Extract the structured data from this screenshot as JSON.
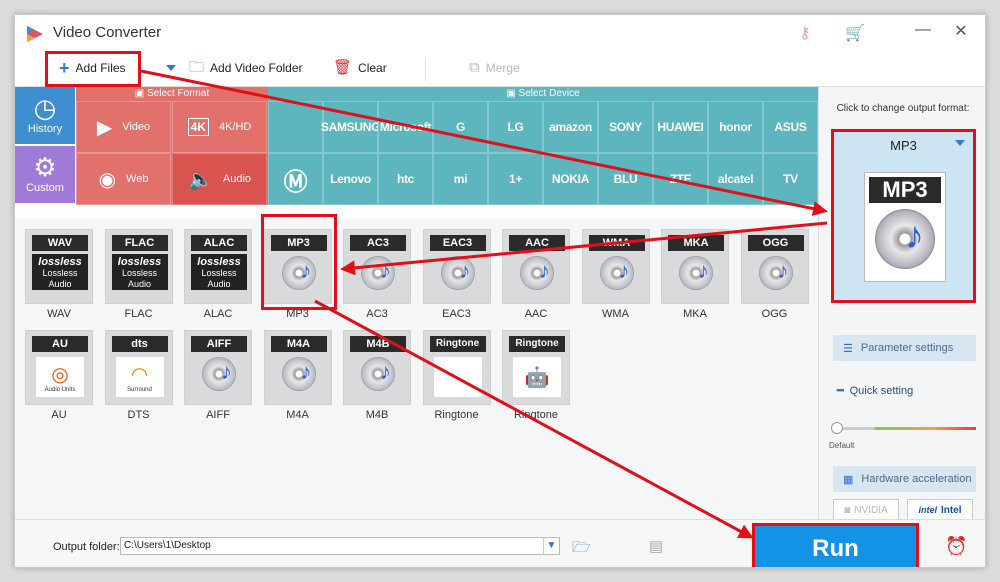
{
  "window": {
    "title": "Video Converter"
  },
  "toolbar": {
    "add_files": "Add Files",
    "add_video_folder": "Add Video Folder",
    "clear": "Clear",
    "merge": "Merge"
  },
  "format_bar": {
    "select_format": "Select Format",
    "select_device": "Select Device",
    "side": [
      {
        "label": "History",
        "icon": "clock-icon"
      },
      {
        "label": "Custom",
        "icon": "gear-icon"
      }
    ],
    "formats": [
      {
        "label": "Video",
        "icon": "play-icon"
      },
      {
        "label": "4K/HD",
        "icon": "4k-icon"
      },
      {
        "label": "Web",
        "icon": "chrome-icon"
      },
      {
        "label": "Audio",
        "icon": "speaker-icon"
      }
    ],
    "devices_row1": [
      "",
      "SAMSUNG",
      "Microsoft",
      "G",
      "LG",
      "amazon",
      "SONY",
      "HUAWEI",
      "honor",
      "ASUS"
    ],
    "devices_row2": [
      "",
      "Lenovo",
      "htc",
      "mi",
      "1+",
      "NOKIA",
      "BLU",
      "ZTE",
      "alcatel",
      "TV"
    ]
  },
  "audio_formats": [
    {
      "badge": "WAV",
      "label": "WAV",
      "style": "lossless"
    },
    {
      "badge": "FLAC",
      "label": "FLAC",
      "style": "lossless"
    },
    {
      "badge": "ALAC",
      "label": "ALAC",
      "style": "lossless"
    },
    {
      "badge": "MP3",
      "label": "MP3",
      "style": "disc"
    },
    {
      "badge": "AC3",
      "label": "AC3",
      "style": "disc"
    },
    {
      "badge": "EAC3",
      "label": "EAC3",
      "style": "disc"
    },
    {
      "badge": "AAC",
      "label": "AAC",
      "style": "disc"
    },
    {
      "badge": "WMA",
      "label": "WMA",
      "style": "disc"
    },
    {
      "badge": "MKA",
      "label": "MKA",
      "style": "disc"
    },
    {
      "badge": "OGG",
      "label": "OGG",
      "style": "disc"
    },
    {
      "badge": "AU",
      "label": "AU",
      "style": "special",
      "sub": "Audio Units"
    },
    {
      "badge": "dts",
      "label": "DTS",
      "style": "special",
      "sub": "Surround"
    },
    {
      "badge": "AIFF",
      "label": "AIFF",
      "style": "disc"
    },
    {
      "badge": "M4A",
      "label": "M4A",
      "style": "disc"
    },
    {
      "badge": "M4B",
      "label": "M4B",
      "style": "disc"
    },
    {
      "badge": "Ringtone",
      "label": "Ringtone",
      "style": "special",
      "sub": ""
    },
    {
      "badge": "Ringtone",
      "label": "Ringtone",
      "style": "special",
      "sub": ""
    }
  ],
  "lossless_text": {
    "brand": "lossless",
    "line1": "Lossless",
    "line2": "Audio"
  },
  "right_panel": {
    "caption": "Click to change output format:",
    "output_format": "MP3",
    "parameter_settings": "Parameter settings",
    "quick_setting": "Quick setting",
    "default_label": "Default",
    "quality_level": 0,
    "hardware_acceleration": "Hardware acceleration",
    "nvidia": "NVIDIA",
    "intel": "Intel"
  },
  "bottom": {
    "output_folder_label": "Output folder:",
    "output_folder_value": "C:\\Users\\1\\Desktop",
    "run": "Run"
  },
  "colors": {
    "accent": "#1492e6",
    "format_red": "#e2716b",
    "device_teal": "#5db5bd",
    "side_blue": "#3e8ed0",
    "side_purple": "#a07ad8",
    "annotation_red": "#e0101a"
  }
}
